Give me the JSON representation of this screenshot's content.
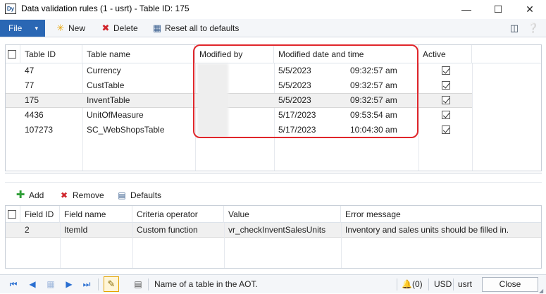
{
  "window": {
    "title": "Data validation rules (1 - usrt) - Table ID: 175",
    "app_icon": "Dy",
    "minimize": "—",
    "maximize": "☐",
    "close": "✕"
  },
  "toolbar": {
    "file_label": "File",
    "file_arrow": "▾",
    "new_label": "New",
    "delete_label": "Delete",
    "reset_label": "Reset all to defaults",
    "icons": {
      "new": "sparkle-icon",
      "delete": "red-x-icon",
      "reset": "reset-icon"
    }
  },
  "upper_grid": {
    "columns": [
      "Table ID",
      "Table name",
      "Modified by",
      "Modified date and time",
      "",
      "Active"
    ],
    "rows": [
      {
        "table_id": "47",
        "table_name": "Currency",
        "modified_by": "",
        "date": "5/5/2023",
        "time": "09:32:57 am",
        "active": true
      },
      {
        "table_id": "77",
        "table_name": "CustTable",
        "modified_by": "",
        "date": "5/5/2023",
        "time": "09:32:57 am",
        "active": true
      },
      {
        "table_id": "175",
        "table_name": "InventTable",
        "modified_by": "",
        "date": "5/5/2023",
        "time": "09:32:57 am",
        "active": true
      },
      {
        "table_id": "4436",
        "table_name": "UnitOfMeasure",
        "modified_by": "",
        "date": "5/17/2023",
        "time": "09:53:54 am",
        "active": true
      },
      {
        "table_id": "107273",
        "table_name": "SC_WebShopsTable",
        "modified_by": "",
        "date": "5/17/2023",
        "time": "10:04:30 am",
        "active": true
      }
    ],
    "selected_row": 2,
    "highlight_color": "#e0262b"
  },
  "lower_toolbar": {
    "add_label": "Add",
    "remove_label": "Remove",
    "defaults_label": "Defaults"
  },
  "lower_grid": {
    "columns": [
      "Field ID",
      "Field name",
      "Criteria operator",
      "Value",
      "Error message"
    ],
    "rows": [
      {
        "field_id": "2",
        "field_name": "ItemId",
        "criteria": "Custom function",
        "value": "vr_checkInventSalesUnits",
        "error": "Inventory and sales units should be filled in."
      }
    ]
  },
  "statusbar": {
    "help_text": "Name of a table in the AOT.",
    "notifications": "(0)",
    "currency": "USD",
    "company": "usrt",
    "close_label": "Close"
  },
  "colors": {
    "accent": "#2a67b4",
    "toolbar_bg": "#f4f6f9"
  }
}
